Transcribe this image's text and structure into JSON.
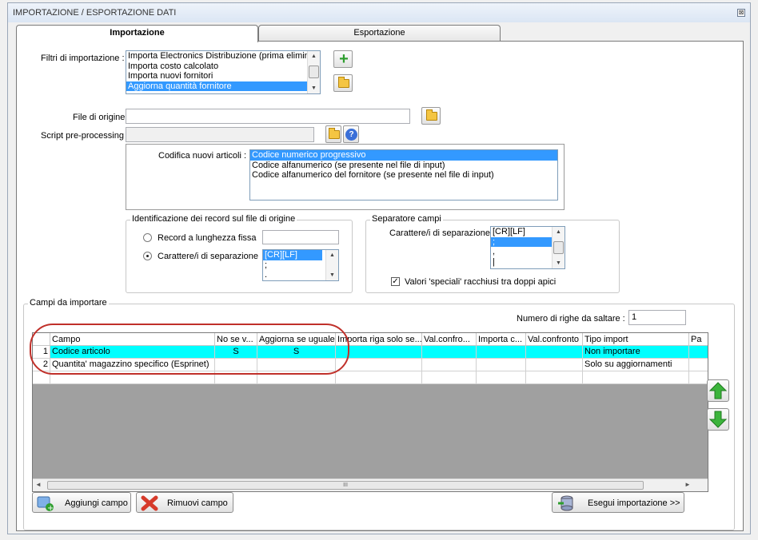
{
  "window": {
    "title": "IMPORTAZIONE / ESPORTAZIONE DATI",
    "close_glyph": "⊠"
  },
  "tabs": [
    {
      "label": "Importazione",
      "active": true
    },
    {
      "label": "Esportazione",
      "active": false
    }
  ],
  "filters": {
    "label": "Filtri di importazione :",
    "items": [
      "Importa Electronics Distribuzione (prima elimino",
      "Importa costo calcolato",
      "Importa nuovi fornitori",
      "Aggiorna quantità fornitore"
    ],
    "selected_index": 3
  },
  "source_file": {
    "label": "File di origine :",
    "value": ""
  },
  "preprocessing": {
    "label": "Script pre-processing :",
    "value": ""
  },
  "encoding": {
    "label": "Codifica nuovi articoli :",
    "items": [
      "Codice numerico progressivo",
      "Codice alfanumerico (se presente nel file di input)",
      "Codice alfanumerico del fornitore (se presente nel file di input)"
    ],
    "selected_index": 0
  },
  "record_identification": {
    "legend": "Identificazione dei record sul file di origine",
    "fixed_length_label": "Record a lunghezza fissa",
    "fixed_length_value": "",
    "separator_label": "Carattere/i di separazione",
    "separator_items": [
      "[CR][LF]",
      ";",
      "."
    ],
    "selected": "separator"
  },
  "field_separator": {
    "legend": "Separatore campi",
    "label": "Carattere/i di separazione",
    "items": [
      "[CR][LF]",
      ";",
      ",",
      "|"
    ],
    "quoted_label": "Valori 'speciali' racchiusi tra doppi apici",
    "quoted_checked": true
  },
  "fields": {
    "legend": "Campi da importare",
    "skip_rows_label": "Numero di righe da saltare  :",
    "skip_rows_value": "1",
    "columns": [
      "Campo",
      "No se v...",
      "Aggiorna se uguale",
      "Importa riga solo se...",
      "Val.confro...",
      "Importa c...",
      "Val.confronto",
      "Tipo import",
      "Pa"
    ],
    "rows": [
      {
        "num": "1",
        "campo": "Codice articolo",
        "no_se_v": "S",
        "aggiorna": "S",
        "importa_riga": "",
        "val_confro": "",
        "importa_c": "",
        "val_confronto": "",
        "tipo_import": "Non importare"
      },
      {
        "num": "2",
        "campo": "Quantita' magazzino specifico (Esprinet)",
        "no_se_v": "",
        "aggiorna": "",
        "importa_riga": "",
        "val_confro": "",
        "importa_c": "",
        "val_confronto": "",
        "tipo_import": "Solo su aggiornamenti"
      }
    ],
    "hscroll_thumb_glyph": "III"
  },
  "buttons": {
    "add_field": "Aggiungi campo",
    "remove_field": "Rimuovi campo",
    "run_import": "Esegui importazione >>"
  },
  "colors": {
    "selection": "#3399ff",
    "row_highlight": "#00ffff",
    "annotation": "#c0302a"
  }
}
